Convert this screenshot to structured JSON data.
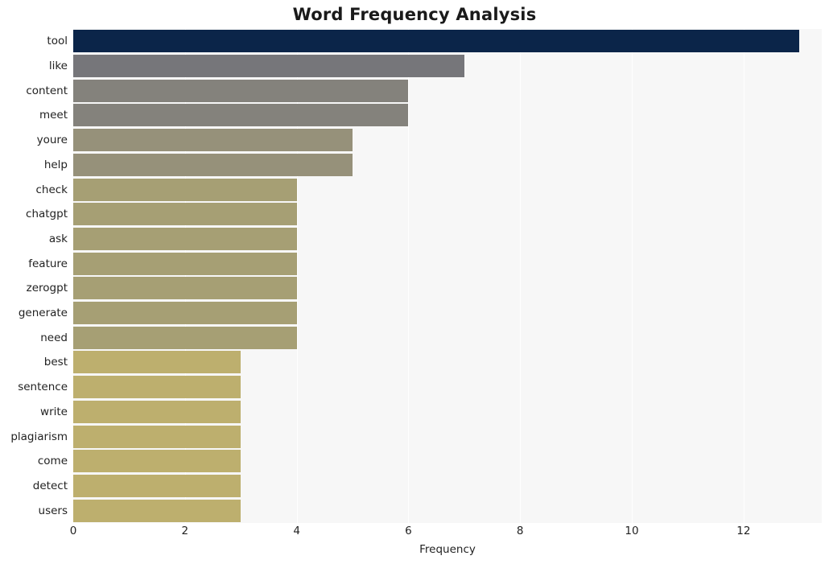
{
  "chart_data": {
    "type": "bar",
    "orientation": "horizontal",
    "title": "Word Frequency Analysis",
    "xlabel": "Frequency",
    "ylabel": "",
    "xlim": [
      0,
      13.4
    ],
    "grid": true,
    "legend": null,
    "categories": [
      "tool",
      "like",
      "content",
      "meet",
      "youre",
      "help",
      "check",
      "chatgpt",
      "ask",
      "feature",
      "zerogpt",
      "generate",
      "need",
      "best",
      "sentence",
      "write",
      "plagiarism",
      "come",
      "detect",
      "users"
    ],
    "values": [
      13,
      7,
      6,
      6,
      5,
      5,
      4,
      4,
      4,
      4,
      4,
      4,
      4,
      3,
      3,
      3,
      3,
      3,
      3,
      3
    ],
    "bar_colors": [
      "#0b2549",
      "#76767a",
      "#84827c",
      "#84827c",
      "#96917a",
      "#96917a",
      "#a69f74",
      "#a69f74",
      "#a69f74",
      "#a69f74",
      "#a69f74",
      "#a69f74",
      "#a69f74",
      "#bdaf6e",
      "#bdaf6e",
      "#bdaf6e",
      "#bdaf6e",
      "#bdaf6e",
      "#bdaf6e",
      "#bdaf6e"
    ],
    "xticks": [
      0,
      2,
      4,
      6,
      8,
      10,
      12
    ],
    "xtick_labels": [
      "0",
      "2",
      "4",
      "6",
      "8",
      "10",
      "12"
    ],
    "plot_background": "#f7f7f7"
  }
}
